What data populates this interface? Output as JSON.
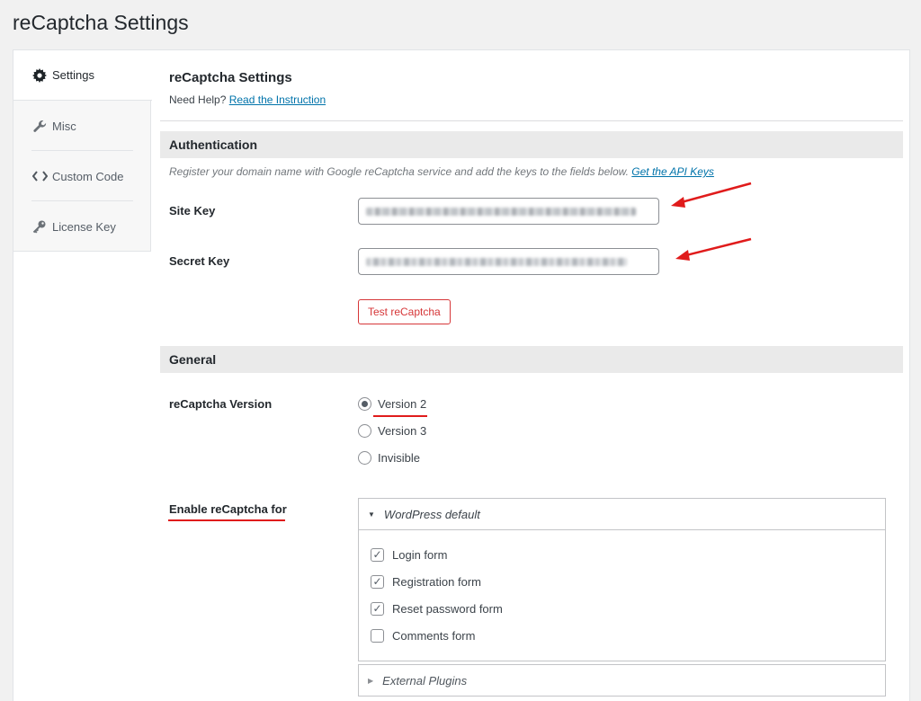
{
  "page_title": "reCaptcha Settings",
  "sidebar": {
    "items": [
      {
        "label": "Settings",
        "icon": "gear-icon"
      },
      {
        "label": "Misc",
        "icon": "wrench-icon"
      },
      {
        "label": "Custom Code",
        "icon": "code-icon"
      },
      {
        "label": "License Key",
        "icon": "key-icon"
      }
    ]
  },
  "main": {
    "title": "reCaptcha Settings",
    "help_prefix": "Need Help?",
    "help_link": "Read the Instruction",
    "auth": {
      "heading": "Authentication",
      "description": "Register your domain name with Google reCaptcha service and add the keys to the fields below.",
      "api_link": "Get the API Keys",
      "site_key_label": "Site Key",
      "secret_key_label": "Secret Key",
      "test_button": "Test reCaptcha"
    },
    "general": {
      "heading": "General",
      "version_label": "reCaptcha Version",
      "versions": [
        "Version 2",
        "Version 3",
        "Invisible"
      ],
      "selected_version": "Version 2",
      "enable_label": "Enable reCaptcha for",
      "wp_default_heading": "WordPress default",
      "wp_default_options": [
        {
          "label": "Login form",
          "checked": true
        },
        {
          "label": "Registration form",
          "checked": true
        },
        {
          "label": "Reset password form",
          "checked": true
        },
        {
          "label": "Comments form",
          "checked": false
        }
      ],
      "external_heading": "External Plugins"
    }
  },
  "colors": {
    "annotation_red": "#e01b1b",
    "link_blue": "#0073aa",
    "button_red": "#d63638"
  }
}
